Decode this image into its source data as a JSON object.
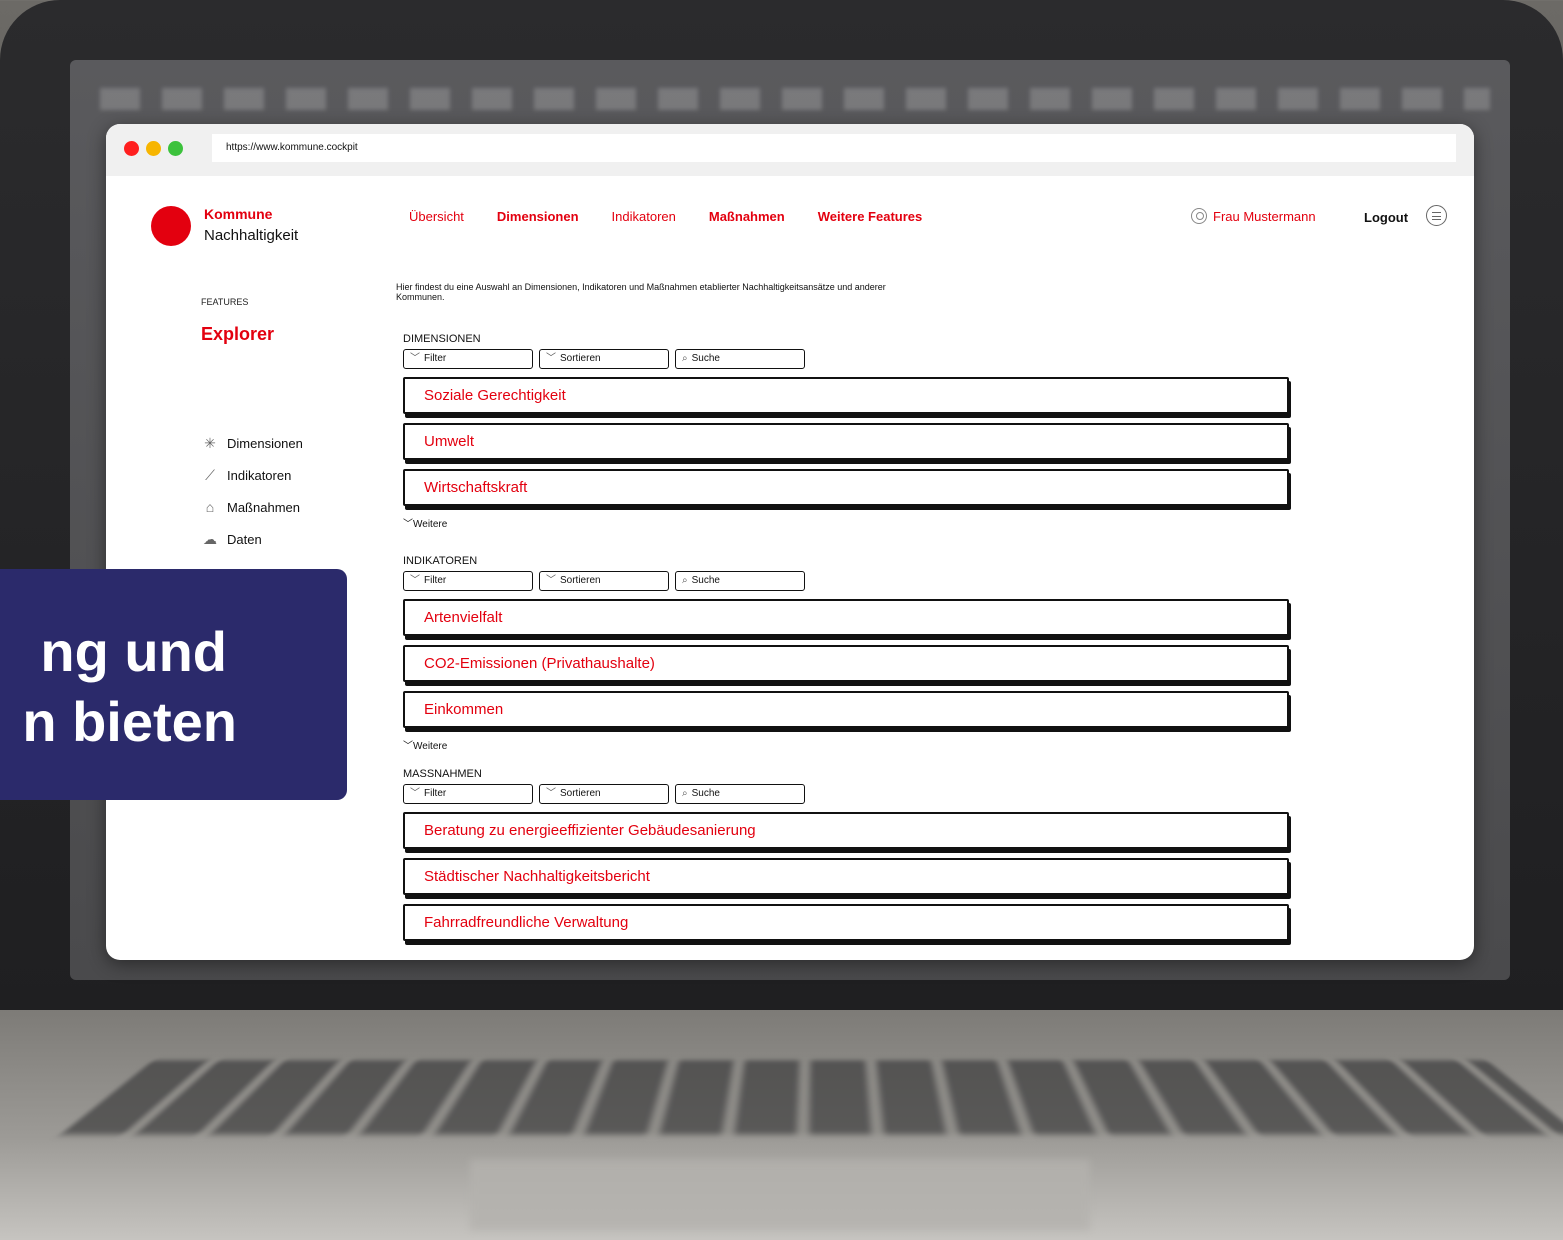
{
  "browser": {
    "url": "https://www.kommune.cockpit"
  },
  "brand": {
    "line1": "Kommune",
    "line2": "Nachhaltigkeit"
  },
  "nav": [
    {
      "label": "Übersicht",
      "bold": false
    },
    {
      "label": "Dimensionen",
      "bold": true
    },
    {
      "label": "Indikatoren",
      "bold": false
    },
    {
      "label": "Maßnahmen",
      "bold": true
    },
    {
      "label": "Weitere Features",
      "bold": true
    }
  ],
  "user": {
    "name": "Frau Mustermann",
    "logout": "Logout"
  },
  "sidebar": {
    "features_label": "FEATURES",
    "title": "Explorer",
    "items": [
      {
        "label": "Dimensionen",
        "icon": "network-icon"
      },
      {
        "label": "Indikatoren",
        "icon": "ruler-icon"
      },
      {
        "label": "Maßnahmen",
        "icon": "building-icon"
      },
      {
        "label": "Daten",
        "icon": "cloud-data-icon"
      }
    ]
  },
  "intro": "Hier findest du eine Auswahl an Dimensionen, Indikatoren und Maßnahmen etablierter Nachhaltigkeitsansätze und anderer Kommunen.",
  "controls": {
    "filter": "Filter",
    "sort": "Sortieren",
    "search": "Suche"
  },
  "more_label": "Weitere",
  "sections": {
    "dimensionen": {
      "title": "DIMENSIONEN",
      "items": [
        "Soziale Gerechtigkeit",
        "Umwelt",
        "Wirtschaftskraft"
      ]
    },
    "indikatoren": {
      "title": "INDIKATOREN",
      "items": [
        "Artenvielfalt",
        "CO2-Emissionen (Privathaushalte)",
        "Einkommen"
      ]
    },
    "massnahmen": {
      "title": "MASSNAHMEN",
      "items": [
        "Beratung zu energieeffizienter Gebäudesanierung",
        "Städtischer Nachhaltigkeitsbericht",
        "Fahrradfreundliche Verwaltung"
      ]
    }
  },
  "overlay": {
    "line1": "ng und",
    "line2": "n bieten"
  },
  "colors": {
    "accent": "#e3000f",
    "overlay_bg": "#2b2a6b"
  }
}
